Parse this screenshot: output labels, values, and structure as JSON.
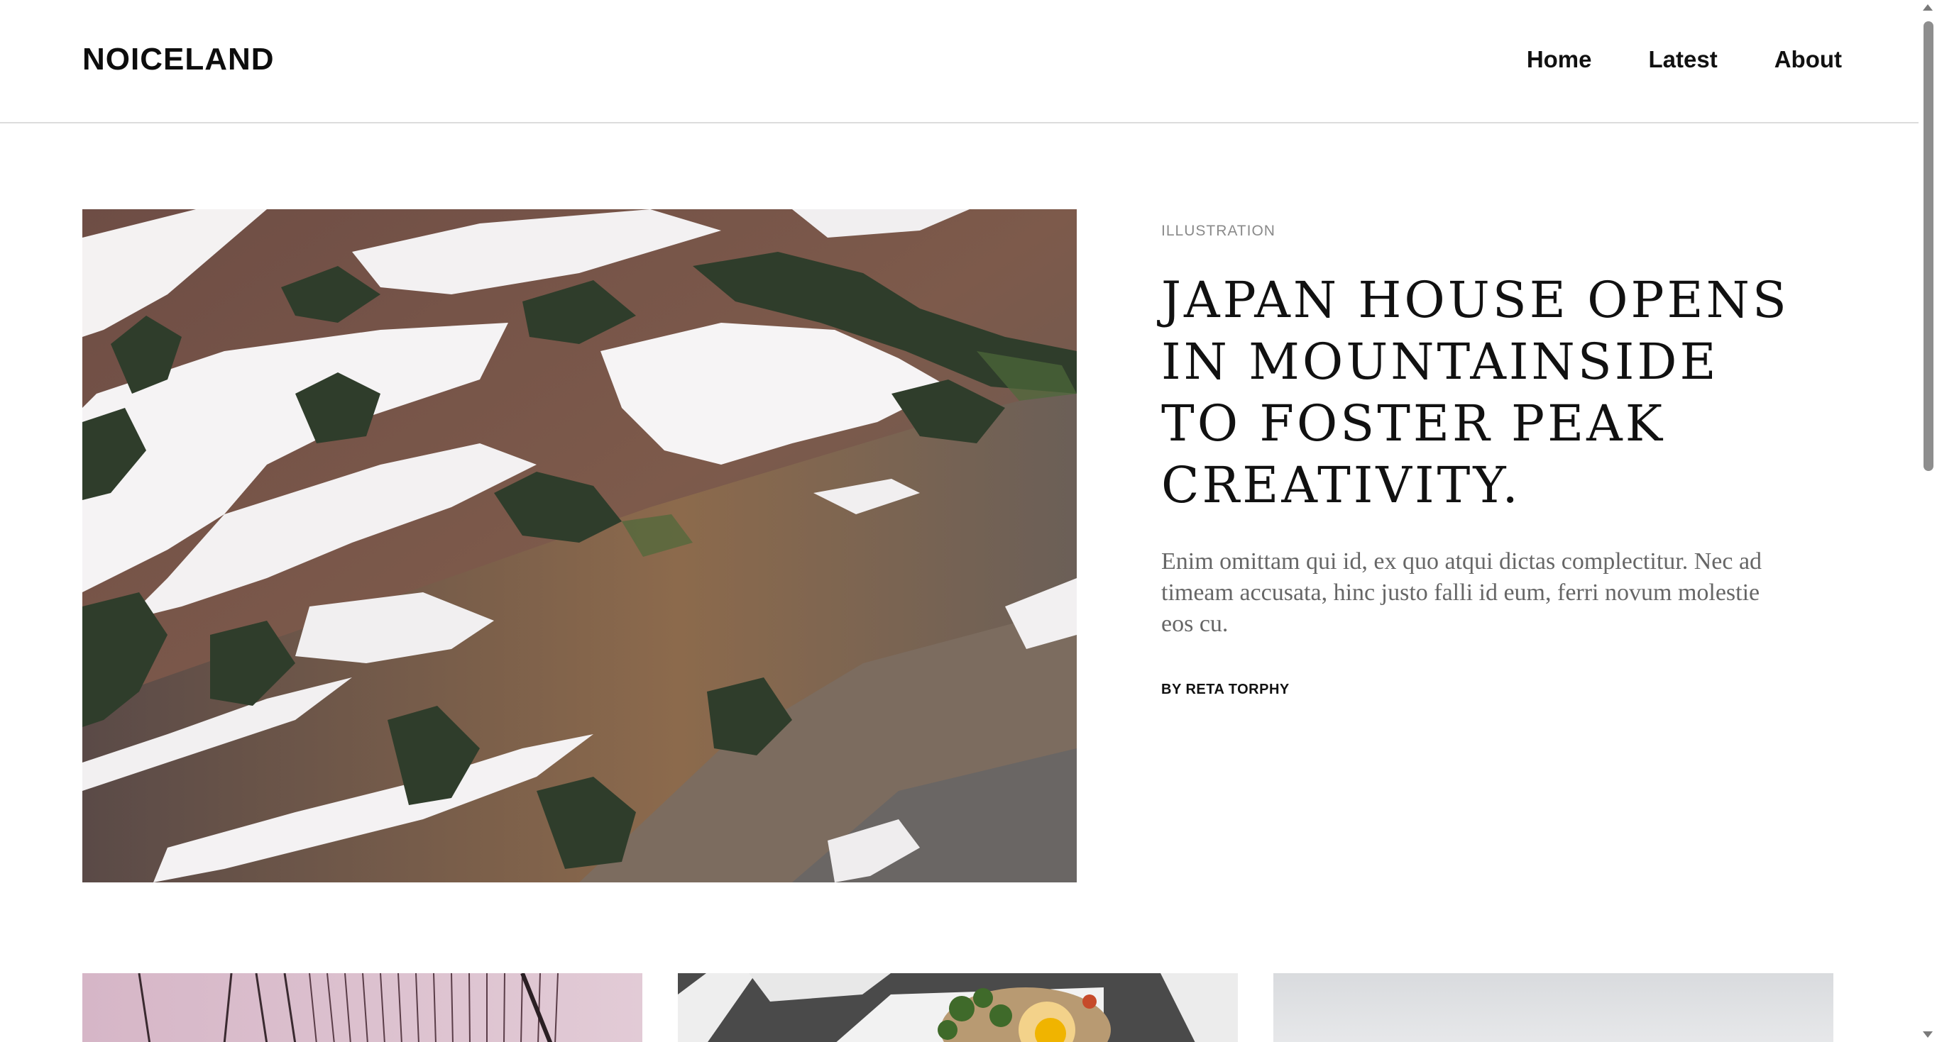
{
  "header": {
    "logo": "NOICELAND",
    "nav": [
      "Home",
      "Latest",
      "About"
    ]
  },
  "featured": {
    "category": "ILLUSTRATION",
    "title": "JAPAN HOUSE OPENS IN MOUNTAINSIDE TO FOSTER PEAK CREATIVITY.",
    "excerpt": "Enim omittam qui id, ex quo atqui dictas complectitur. Nec ad timeam accusata, hinc justo falli id eum, ferri novum molestie eos cu.",
    "byline": "BY RETA TORPHY",
    "image": "snowy-mountain-slopes-photo"
  },
  "cards": [
    {
      "image": "bridge-cables-photo"
    },
    {
      "image": "food-plate-photo"
    },
    {
      "image": "foggy-sky-photo"
    }
  ],
  "colors": {
    "text": "#111111",
    "muted": "#8a8a8a",
    "excerpt": "#666666",
    "divider": "#dcdcdc"
  }
}
